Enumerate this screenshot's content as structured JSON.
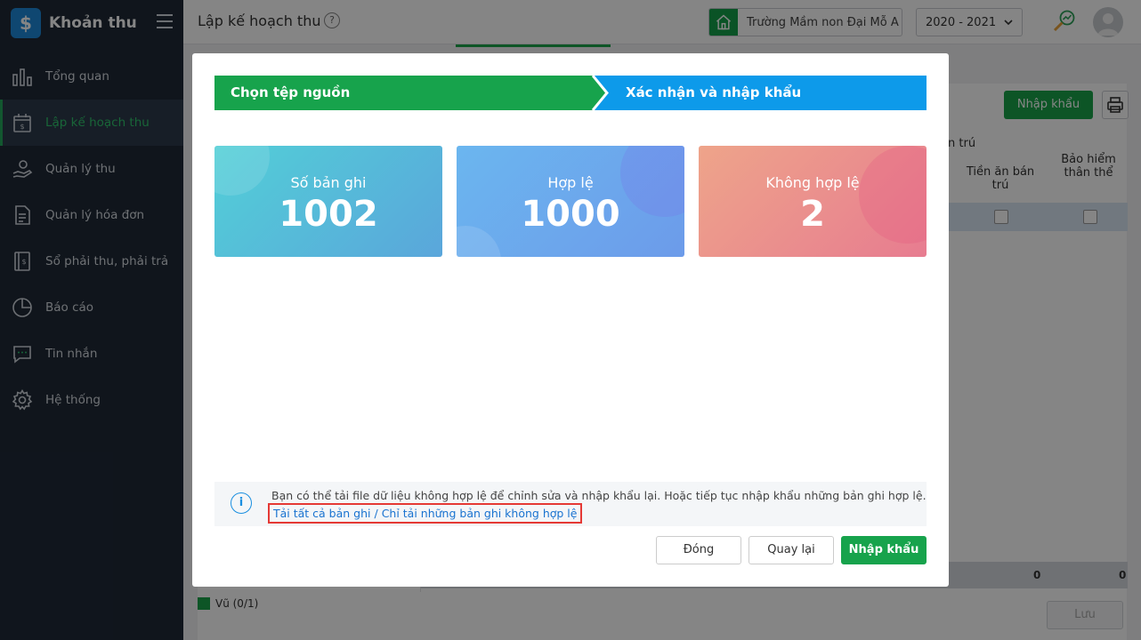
{
  "app": {
    "title": "Khoản thu",
    "logo_glyph": "$"
  },
  "sidebar": {
    "items": [
      {
        "label": "Tổng quan",
        "icon": "bar-chart-icon",
        "active": false
      },
      {
        "label": "Lập kế hoạch thu",
        "icon": "calendar-money-icon",
        "active": true
      },
      {
        "label": "Quản lý thu",
        "icon": "hand-money-icon",
        "active": false
      },
      {
        "label": "Quản lý hóa đơn",
        "icon": "invoice-icon",
        "active": false
      },
      {
        "label": "Sổ phải thu, phải trả",
        "icon": "ledger-book-icon",
        "active": false
      },
      {
        "label": "Báo cáo",
        "icon": "pie-chart-icon",
        "active": false
      },
      {
        "label": "Tin nhắn",
        "icon": "chat-icon",
        "active": false
      },
      {
        "label": "Hệ thống",
        "icon": "gear-icon",
        "active": false
      }
    ]
  },
  "header": {
    "page_title": "Lập kế hoạch thu",
    "help_glyph": "?",
    "school_name": "Trường Mầm non Đại Mỗ A",
    "year": "2020 - 2021"
  },
  "background": {
    "import_label": "Nhập khẩu",
    "col_partial": "n trú",
    "col_meal": "Tiền ăn bán trú",
    "col_insurance": "Bảo hiểm thân thể",
    "zero_a": "0",
    "zero_b": "0",
    "save_label": "Lưu",
    "left_list_item": "Vũ (0/1)"
  },
  "modal": {
    "step1_label": "Chọn tệp nguồn",
    "step2_label": "Xác nhận và nhập khẩu",
    "cards": {
      "total": {
        "label": "Số bản ghi",
        "value": "1002"
      },
      "valid": {
        "label": "Hợp lệ",
        "value": "1000"
      },
      "invalid": {
        "label": "Không hợp lệ",
        "value": "2"
      }
    },
    "info_text": "Bạn có thể tải file dữ liệu không hợp lệ để chỉnh sửa và nhập khẩu lại. Hoặc tiếp tục nhập khẩu những bản ghi hợp lệ.",
    "info_glyph": "i",
    "link_all": "Tải tất cả bản ghi",
    "link_sep": " / ",
    "link_invalid": "Chỉ tải những bản ghi không hợp lệ",
    "buttons": {
      "close": "Đóng",
      "back": "Quay lại",
      "import": "Nhập khẩu"
    }
  },
  "colors": {
    "sidebar_bg": "#1f2937",
    "accent_green": "#17a34c",
    "step_blue": "#0d9aea",
    "link_blue": "#1a73d0",
    "highlight_red": "#e53935"
  }
}
